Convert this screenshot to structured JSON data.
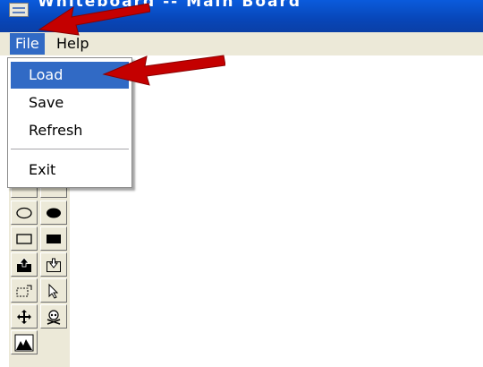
{
  "window": {
    "title": "Whiteboard -- Main Board",
    "icon": "window-icon"
  },
  "menubar": {
    "items": [
      {
        "label": "File",
        "active": true
      },
      {
        "label": "Help",
        "active": false
      }
    ]
  },
  "file_menu": {
    "items": [
      {
        "label": "Load",
        "highlighted": true
      },
      {
        "label": "Save",
        "highlighted": false
      },
      {
        "label": "Refresh",
        "highlighted": false
      },
      {
        "label": "Exit",
        "highlighted": false
      }
    ]
  },
  "toolbox": {
    "tools": [
      {
        "icon": "ellipse-outline-icon",
        "glyph": "○"
      },
      {
        "icon": "ellipse-filled-icon",
        "glyph": "●"
      },
      {
        "icon": "rectangle-outline-icon",
        "glyph": "□"
      },
      {
        "icon": "rectangle-filled-icon",
        "glyph": "■"
      },
      {
        "icon": "upload-icon",
        "glyph": "⇧"
      },
      {
        "icon": "download-icon",
        "glyph": "⇩"
      },
      {
        "icon": "selection-icon",
        "glyph": "⬚"
      },
      {
        "icon": "pointer-icon",
        "glyph": "↖"
      },
      {
        "icon": "move-icon",
        "glyph": "✥"
      },
      {
        "icon": "skull-icon",
        "glyph": "☠"
      },
      {
        "icon": "image-icon",
        "glyph": "▲"
      }
    ]
  },
  "annotations": {
    "arrow_color": "#cc0000"
  },
  "colors": {
    "titlebar": "#0846b8",
    "menu_highlight": "#316ac5",
    "chrome": "#ece9d8"
  }
}
